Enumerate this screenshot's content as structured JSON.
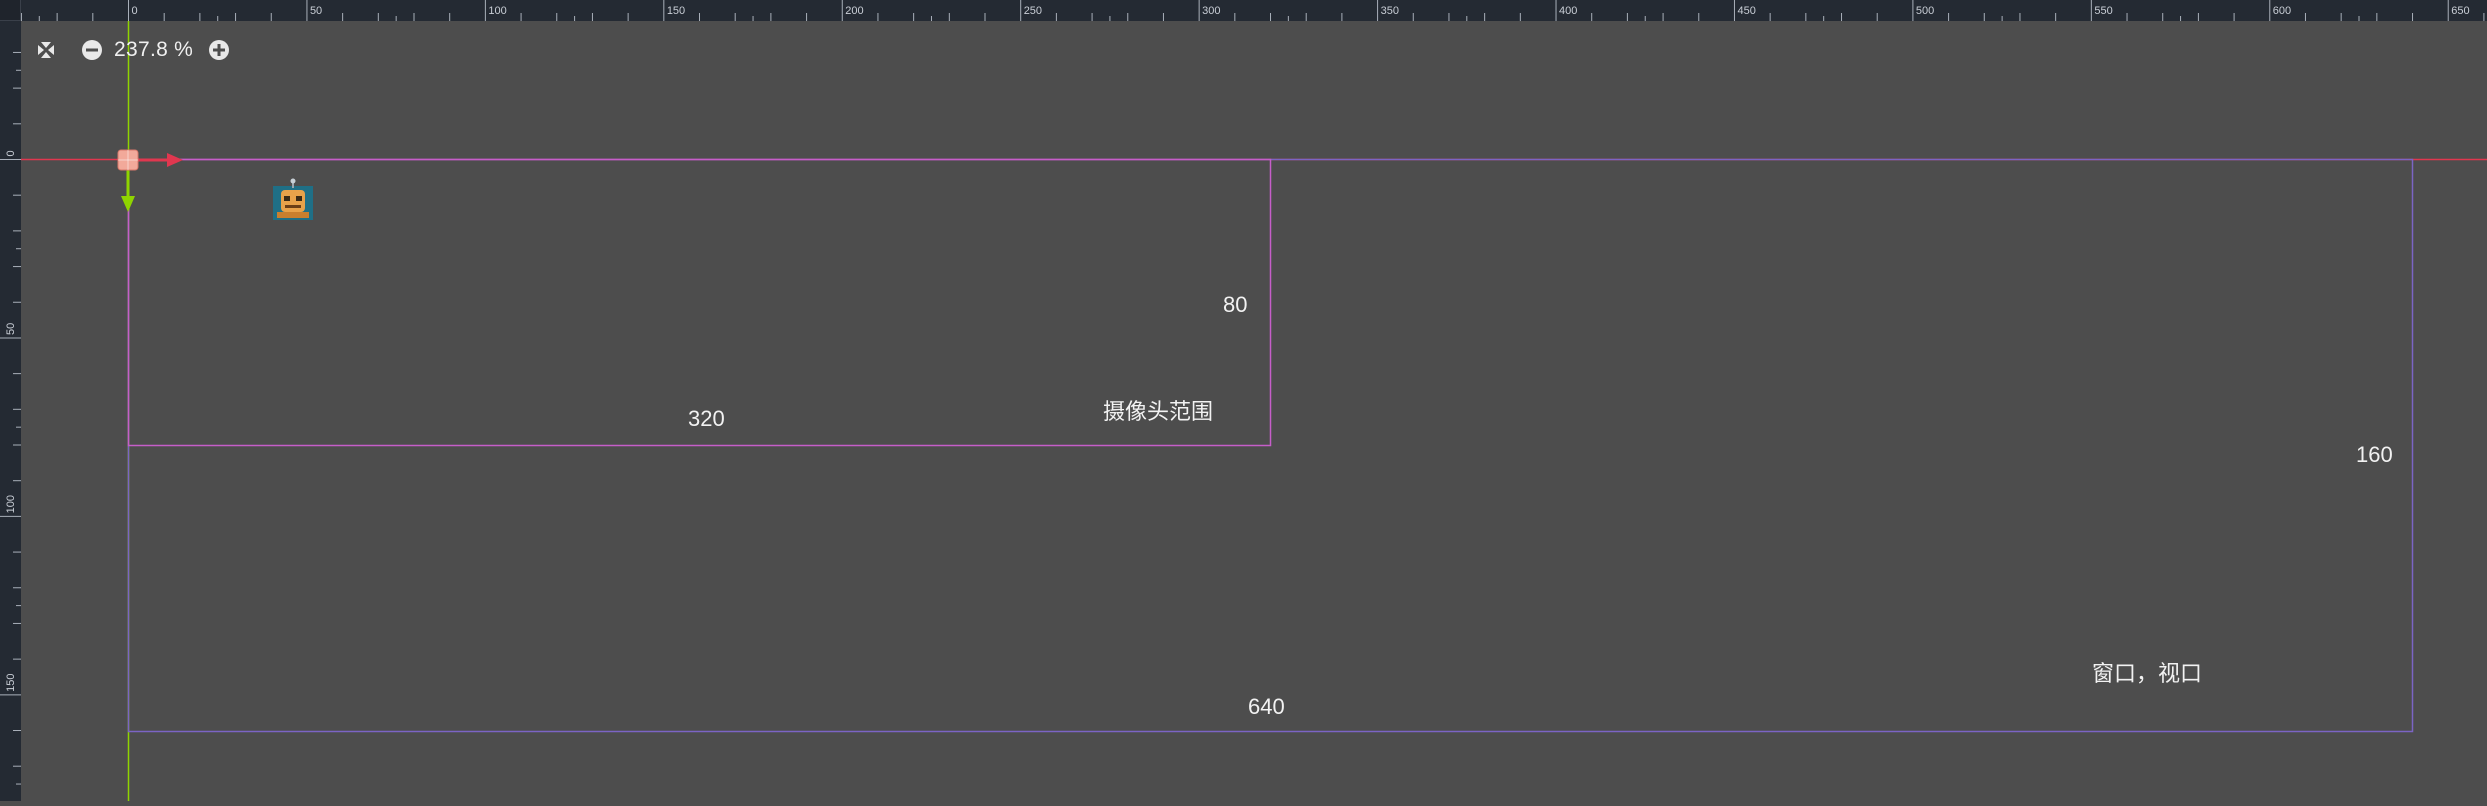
{
  "toolbar": {
    "center_view_icon": "center-view-icon",
    "zoom_out_icon": "zoom-out-icon",
    "zoom_level": "237.8 %",
    "zoom_in_icon": "zoom-in-icon"
  },
  "rulers": {
    "top_labels": [
      "0",
      "50",
      "100",
      "150",
      "200",
      "250",
      "300",
      "350",
      "400",
      "450",
      "500",
      "550",
      "600",
      "650"
    ],
    "left_labels": [
      "0",
      "50",
      "100",
      "150"
    ]
  },
  "canvas": {
    "camera_width_label": "320",
    "camera_height_label": "80",
    "camera_range_label": "摄像头范围",
    "window_width_label": "640",
    "window_height_label": "160",
    "window_viewport_label": "窗口，视口",
    "node_icon": "robot-sprite-icon"
  },
  "colors": {
    "canvas_bg": "#4d4d4d",
    "ruler_bg": "#242a33",
    "x_axis": "#e0374f",
    "y_axis": "#8fd400",
    "camera_rect": "#c65ec9",
    "window_rect": "#7b64c4"
  }
}
